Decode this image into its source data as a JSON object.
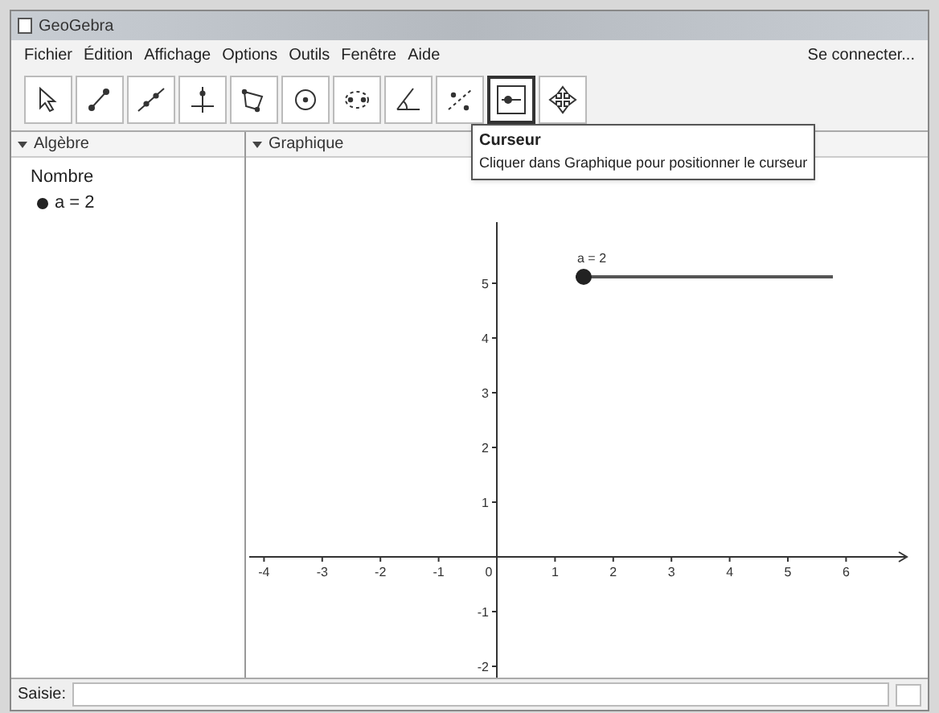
{
  "window": {
    "title": "GeoGebra"
  },
  "menu": [
    "Fichier",
    "Édition",
    "Affichage",
    "Options",
    "Outils",
    "Fenêtre",
    "Aide"
  ],
  "sign_in": "Se connecter...",
  "tools": [
    {
      "kind": "move",
      "selected": false
    },
    {
      "kind": "point",
      "selected": false
    },
    {
      "kind": "line",
      "selected": false
    },
    {
      "kind": "perpendicular",
      "selected": false
    },
    {
      "kind": "polygon",
      "selected": false
    },
    {
      "kind": "circle",
      "selected": false
    },
    {
      "kind": "ellipse",
      "selected": false
    },
    {
      "kind": "angle",
      "selected": false
    },
    {
      "kind": "reflect",
      "selected": false
    },
    {
      "kind": "slider",
      "selected": true
    },
    {
      "kind": "pan",
      "selected": false
    }
  ],
  "tooltip": {
    "title": "Curseur",
    "text": "Cliquer dans Graphique pour positionner le curseur"
  },
  "algebra": {
    "title": "Algèbre",
    "groups": [
      {
        "label": "Nombre",
        "children": [
          {
            "label": "a = 2",
            "visible": true
          }
        ]
      }
    ]
  },
  "graphics": {
    "title": "Graphique",
    "x_ticks": [
      "-4",
      "-3",
      "-2",
      "-1",
      "0",
      "1",
      "2",
      "3",
      "4",
      "5",
      "6"
    ],
    "y_ticks": [
      "5",
      "4",
      "3",
      "2",
      "1",
      "-1",
      "-2"
    ],
    "slider": {
      "label": "a = 2",
      "level": 0
    }
  },
  "input_bar": {
    "label": "Saisie:"
  }
}
